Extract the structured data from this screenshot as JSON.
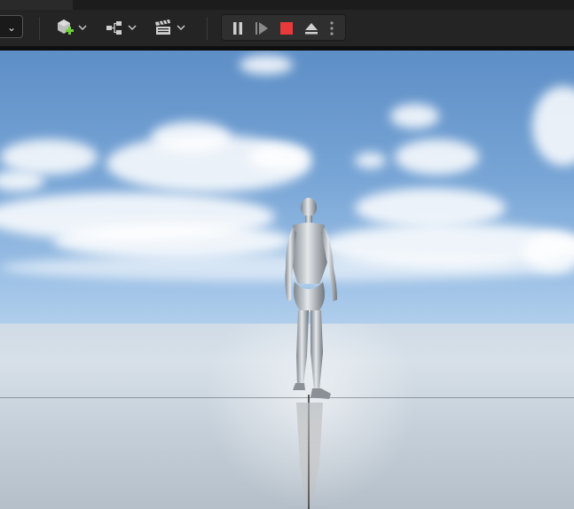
{
  "toolbar": {
    "dropdown_glyph": "⌄",
    "buttons": [
      {
        "name": "add-actor-button",
        "icon": "cube-plus-icon"
      },
      {
        "name": "blueprint-button",
        "icon": "blueprint-nodes-icon"
      },
      {
        "name": "cinematics-button",
        "icon": "clapperboard-icon"
      }
    ],
    "play_controls": [
      {
        "name": "pause-button",
        "icon": "pause-icon"
      },
      {
        "name": "frame-step-button",
        "icon": "step-forward-icon"
      },
      {
        "name": "stop-button",
        "icon": "stop-icon"
      },
      {
        "name": "eject-button",
        "icon": "eject-icon"
      },
      {
        "name": "play-options-button",
        "icon": "vertical-dots-icon"
      }
    ]
  },
  "colors": {
    "toolbar_bg": "#242424",
    "stop_red": "#e83a3a",
    "add_green": "#6fcf3a",
    "sky_top": "#5d8ec6",
    "floor": "#d7e0e8"
  },
  "viewport": {
    "scene": "sky-with-clouds-and-reflective-floor",
    "subject": "silver-mannequin-walking"
  }
}
